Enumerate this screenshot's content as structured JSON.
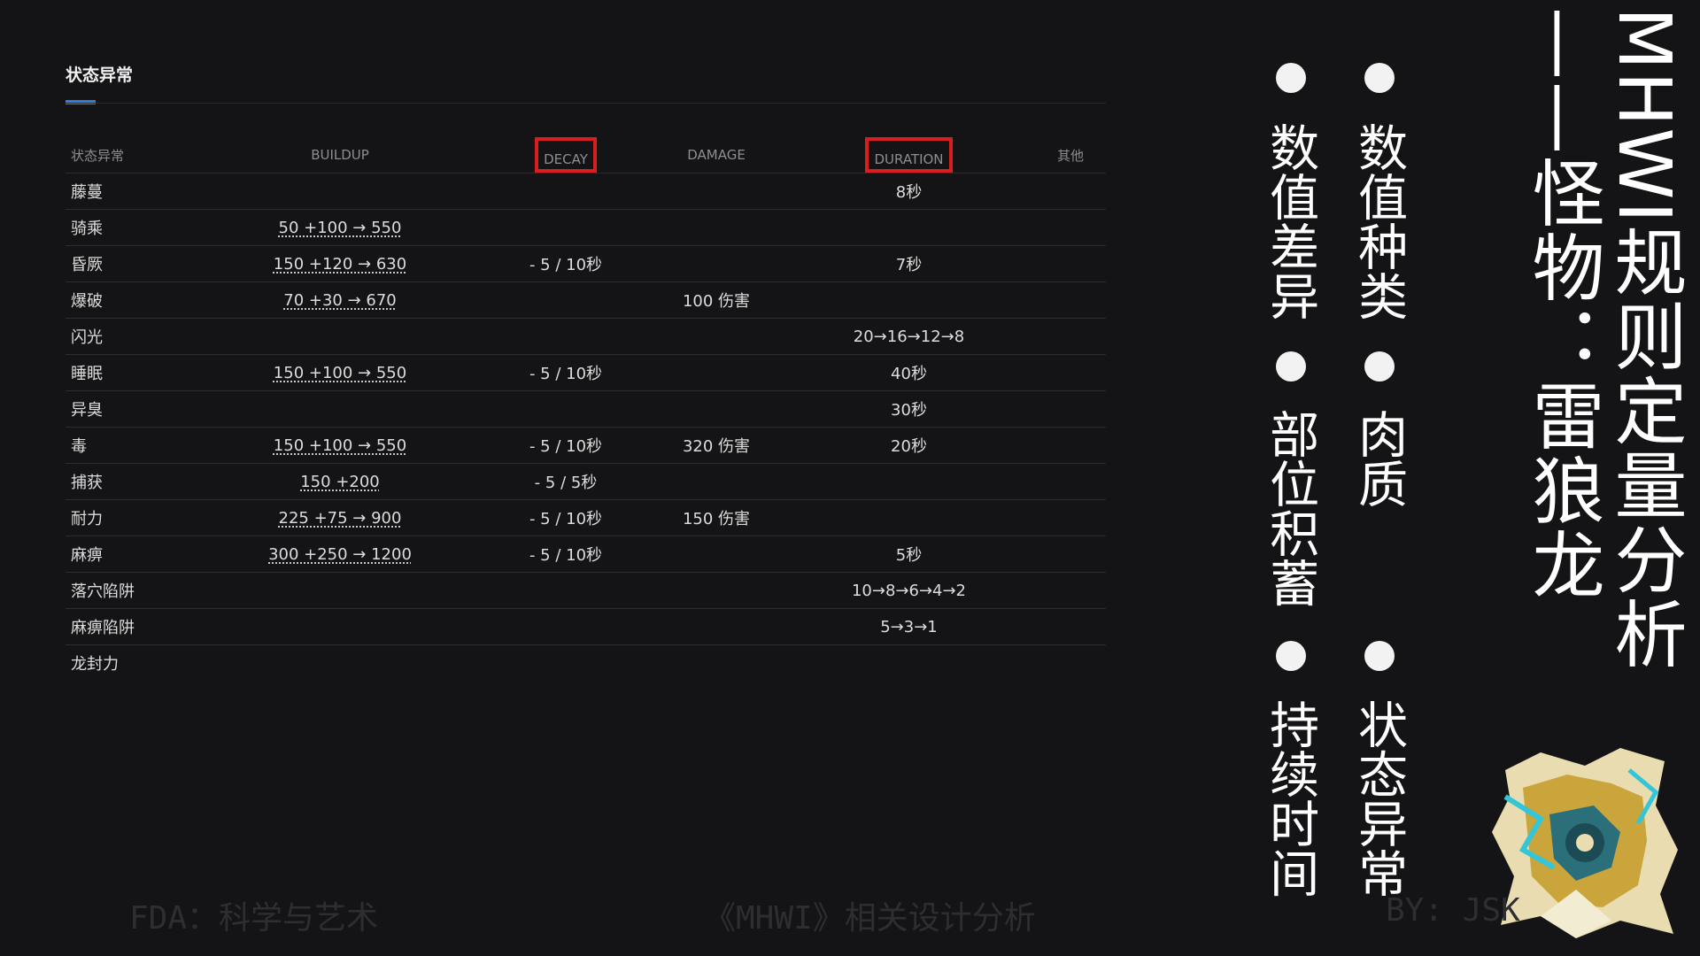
{
  "panel": {
    "title": "状态异常"
  },
  "table": {
    "headers": [
      "状态异常",
      "BUILDUP",
      "DECAY",
      "DAMAGE",
      "DURATION",
      "其他"
    ],
    "rows": [
      [
        "藤蔓",
        "",
        "",
        "",
        "8秒",
        ""
      ],
      [
        "骑乘",
        "50 +100 → 550",
        "",
        "",
        "",
        ""
      ],
      [
        "昏厥",
        "150 +120 → 630",
        "- 5 / 10秒",
        "",
        "7秒",
        ""
      ],
      [
        "爆破",
        "70 +30 → 670",
        "",
        "100 伤害",
        "",
        ""
      ],
      [
        "闪光",
        "",
        "",
        "",
        "20→16→12→8",
        ""
      ],
      [
        "睡眠",
        "150 +100 → 550",
        "- 5 / 10秒",
        "",
        "40秒",
        ""
      ],
      [
        "异臭",
        "",
        "",
        "",
        "30秒",
        ""
      ],
      [
        "毒",
        "150 +100 → 550",
        "- 5 / 10秒",
        "320 伤害",
        "20秒",
        ""
      ],
      [
        "捕获",
        "150 +200",
        "- 5 / 5秒",
        "",
        "",
        ""
      ],
      [
        "耐力",
        "225 +75 → 900",
        "- 5 / 10秒",
        "150 伤害",
        "",
        ""
      ],
      [
        "麻痹",
        "300 +250 → 1200",
        "- 5 / 10秒",
        "",
        "5秒",
        ""
      ],
      [
        "落穴陷阱",
        "",
        "",
        "",
        "10→8→6→4→2",
        ""
      ],
      [
        "麻痹陷阱",
        "",
        "",
        "",
        "5→3→1",
        ""
      ],
      [
        "龙封力",
        "",
        "",
        "",
        "",
        ""
      ]
    ],
    "underlined_buildup": true
  },
  "slide": {
    "title_line1": "MHWI规则定量分析",
    "title_line2": "——怪物：雷狼龙",
    "topics_col_right": [
      "数值种类",
      "肉质",
      "状态异常"
    ],
    "topics_col_left": [
      "数值差异",
      "部位积蓄",
      "持续时间"
    ]
  },
  "footer": {
    "left": "FDA：科学与艺术",
    "center": "《MHWI》相关设计分析",
    "right": "BY: JSK"
  },
  "colors": {
    "highlight_box": "#d91e1e",
    "accent_underline": "#2f7de1",
    "background": "#141416"
  }
}
